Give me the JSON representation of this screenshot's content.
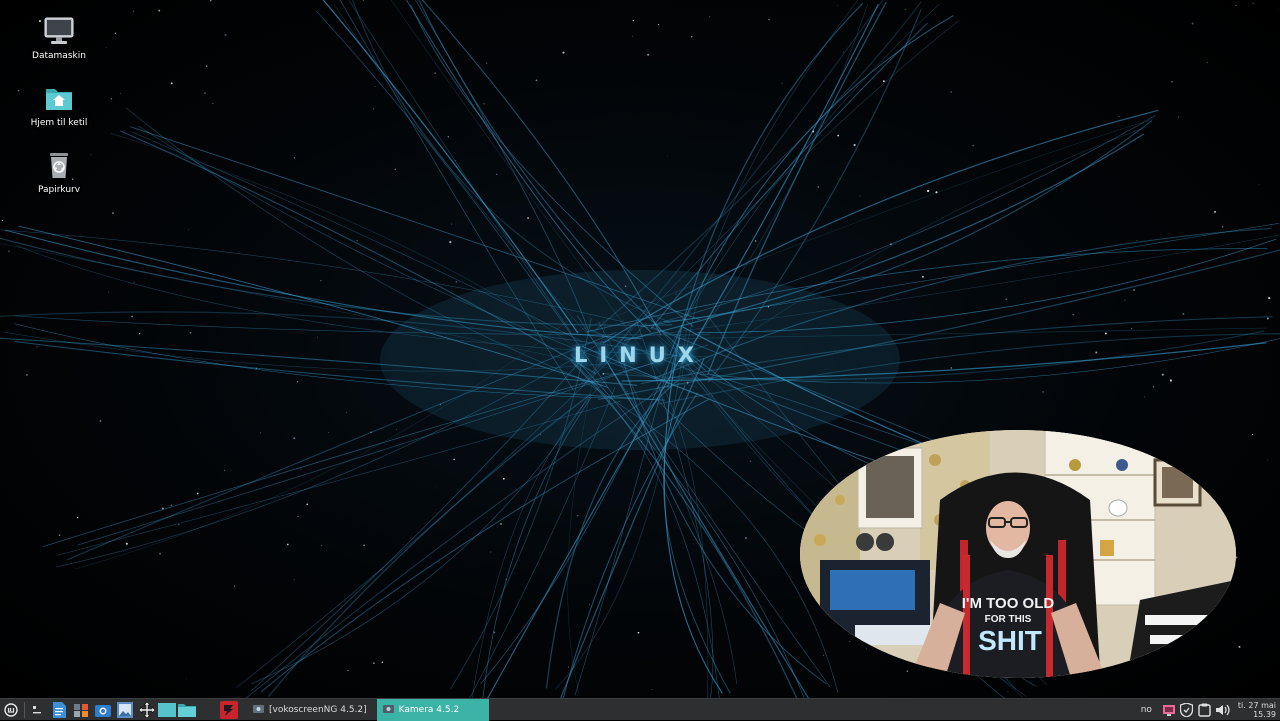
{
  "desktop": {
    "wallpaper_text": "LINUX",
    "icons": [
      {
        "label": "Datamaskin",
        "icon": "computer-icon"
      },
      {
        "label": "Hjem til ketil",
        "icon": "home-folder-icon"
      },
      {
        "label": "Papirkurv",
        "icon": "trash-icon"
      }
    ]
  },
  "webcam": {
    "shirt_line1": "I'M TOO OLD",
    "shirt_line2": "FOR THIS",
    "shirt_line3": "SHIT"
  },
  "taskbar": {
    "launchers": [
      "menu-icon",
      "show-desktop-icon",
      "text-editor-icon",
      "settings-icon",
      "screenshot-icon",
      "image-viewer-icon",
      "move-icon",
      "file-manager-icon",
      "red-app-icon"
    ],
    "tasks": [
      {
        "label": "[vokoscreenNG 4.5.2]",
        "active": false
      },
      {
        "label": "Kamera 4.5.2",
        "active": true
      }
    ],
    "tray": {
      "language": "no",
      "icons": [
        "network-icon",
        "shield-icon",
        "clipboard-icon",
        "volume-icon"
      ]
    },
    "clock": {
      "date": "ti. 27 mai",
      "time": "15.39"
    }
  },
  "colors": {
    "taskbar_bg": "#2e2f31",
    "active_task": "#3cb3a7",
    "folder_teal": "#4fbdc4",
    "wallpaper_glow": "#3aa0d0"
  }
}
